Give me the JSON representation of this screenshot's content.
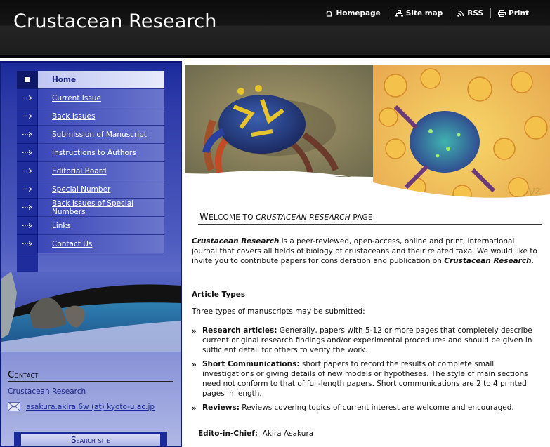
{
  "header": {
    "title": "Crustacean Research",
    "nav": [
      {
        "label": "Homepage",
        "icon": "home-icon"
      },
      {
        "label": "Site map",
        "icon": "sitemap-icon"
      },
      {
        "label": "RSS",
        "icon": "rss-icon"
      },
      {
        "label": "Print",
        "icon": "print-icon"
      }
    ]
  },
  "sidebar": {
    "menu": [
      {
        "label": "Home"
      },
      {
        "label": "Current Issue"
      },
      {
        "label": "Back Issues"
      },
      {
        "label": "Submission of Manuscript"
      },
      {
        "label": "Instructions to Authors"
      },
      {
        "label": "Editorial Board"
      },
      {
        "label": "Special Number"
      },
      {
        "label": "Back Issues of Special Numbers"
      },
      {
        "label": "Links"
      },
      {
        "label": "Contact Us"
      }
    ],
    "active_index": 0,
    "contact": {
      "heading": "Contact",
      "org": "Crustacean Research",
      "email": "asakura.akira.6w (at) kyoto-u.ac.jp"
    },
    "search_label": "Search site"
  },
  "main": {
    "welcome": {
      "prefix": "Welcome to",
      "journal": "Crustacean Research",
      "suffix": "page"
    },
    "intro": {
      "journal": "Crustacean Research",
      "text1": "is a peer-reviewed, open-access, online and print, international journal that covers all fields of biology of crustaceans and their related taxa. We would like to invite you to contribute papers for consideration and publication on",
      "journal2": "Crustacean Research",
      "text2": "."
    },
    "article_types_heading": "Article Types",
    "article_types_lead": "Three types of manuscripts may be submitted:",
    "article_types": [
      {
        "name": "Research articles:",
        "desc": "Generally, papers with 5-12 or more pages that completely describe current original research findings and/or experimental procedures and should be given in sufficient detail for others to verify the work."
      },
      {
        "name": "Short Communications:",
        "desc": "short papers to record the results of complete small investigations or giving details of new models or hypotheses. The style of main sections need not conform to that of full-length papers. Short communications are 2 to 4 printed pages in length."
      },
      {
        "name": "Reviews:",
        "desc": "Reviews covering topics of current interest are welcome and encouraged."
      }
    ],
    "editor": {
      "label": "Edito-in-Chief:",
      "name": "Akira Asakura"
    },
    "hero_signature": "yz"
  },
  "colors": {
    "header_bg": "#151515",
    "sidebar_blue": "#1a2a9a",
    "link_blue": "#1a2486"
  }
}
